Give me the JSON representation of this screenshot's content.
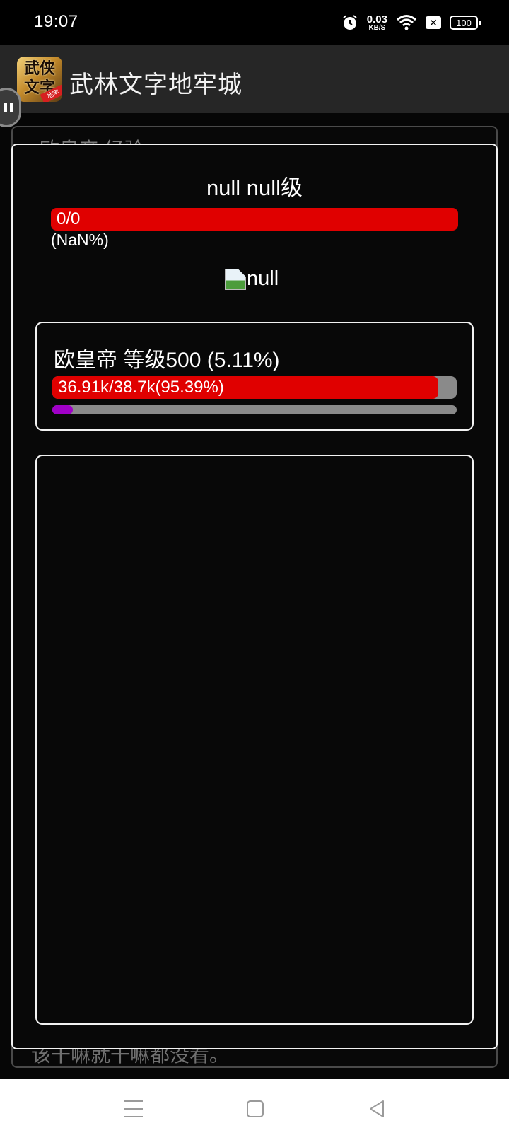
{
  "status_bar": {
    "time": "19:07",
    "net_speed": "0.03",
    "net_unit": "KB/S",
    "battery": "100"
  },
  "app": {
    "title": "武林文字地牢城",
    "icon_text": "武侠\n文字"
  },
  "background_page": {
    "top_text": "欧皇帝 经验",
    "bottom_text": "该干嘛就干嘛都没看。"
  },
  "enemy": {
    "title": "null null级",
    "hp_text": "0/0",
    "hp_percent": "(NaN%)",
    "image_alt": "null"
  },
  "player": {
    "name_level": "欧皇帝 等级500 (5.11%)",
    "hp_text": "36.91k/38.7k(95.39%)",
    "hp_fraction": 0.9539,
    "exp_fraction": 0.0511
  },
  "colors": {
    "hp_bar": "#e00000",
    "exp_bar": "#a000c8",
    "track": "#8a8a8a"
  }
}
